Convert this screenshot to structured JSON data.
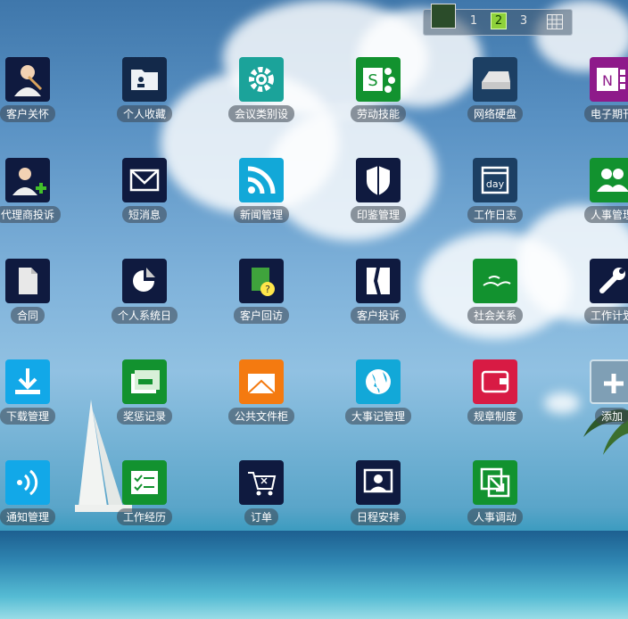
{
  "pager": {
    "pages": [
      "1",
      "2",
      "3"
    ],
    "active_page": "2"
  },
  "apps": [
    {
      "label": "客户关怀",
      "color": "#0f1a3f",
      "icon": "customer-care-icon"
    },
    {
      "label": "个人收藏",
      "color": "#13294a",
      "icon": "contact-card-icon"
    },
    {
      "label": "会议类别设",
      "color": "#1ba39a",
      "icon": "gear-icon"
    },
    {
      "label": "劳动技能",
      "color": "#12922f",
      "icon": "sharepoint-icon"
    },
    {
      "label": "网络硬盘",
      "color": "#1c3f63",
      "icon": "hard-drive-icon"
    },
    {
      "label": "电子期刊",
      "color": "#8e1a8a",
      "icon": "onenote-icon"
    },
    {
      "label": "代理商投诉",
      "color": "#0f1a3f",
      "icon": "add-user-icon"
    },
    {
      "label": "短消息",
      "color": "#0f1a3f",
      "icon": "envelope-icon"
    },
    {
      "label": "新闻管理",
      "color": "#12a8d8",
      "icon": "rss-icon"
    },
    {
      "label": "印鉴管理",
      "color": "#0f1a3f",
      "icon": "shield-icon"
    },
    {
      "label": "工作日志",
      "color": "#1c3f63",
      "icon": "calendar-day-icon",
      "day": "day"
    },
    {
      "label": "人事管理",
      "color": "#12922f",
      "icon": "people-icon"
    },
    {
      "label": "合同",
      "color": "#0f1a3f",
      "icon": "document-icon"
    },
    {
      "label": "个人系统日",
      "color": "#0f1a3f",
      "icon": "pie-chart-icon"
    },
    {
      "label": "客户回访",
      "color": "#0f1a3f",
      "icon": "help-document-icon"
    },
    {
      "label": "客户投诉",
      "color": "#0f1a3f",
      "icon": "torn-document-icon"
    },
    {
      "label": "社会关系",
      "color": "#12922f",
      "icon": "birds-icon"
    },
    {
      "label": "工作计划",
      "color": "#0f1a3f",
      "icon": "wrench-icon"
    },
    {
      "label": "下载管理",
      "color": "#12a8e8",
      "icon": "download-icon"
    },
    {
      "label": "奖惩记录",
      "color": "#12922f",
      "icon": "cards-icon"
    },
    {
      "label": "公共文件柜",
      "color": "#f47a10",
      "icon": "mail-open-icon"
    },
    {
      "label": "大事记管理",
      "color": "#12a8d8",
      "icon": "globe-icon"
    },
    {
      "label": "规章制度",
      "color": "#d81b44",
      "icon": "wallet-icon"
    },
    {
      "label": "添加",
      "color": "#7f9fb5",
      "icon": "plus-icon"
    },
    {
      "label": "通知管理",
      "color": "#12a8e8",
      "icon": "signal-icon"
    },
    {
      "label": "工作经历",
      "color": "#12922f",
      "icon": "checklist-icon"
    },
    {
      "label": "订单",
      "color": "#0f1a3f",
      "icon": "cart-icon"
    },
    {
      "label": "日程安排",
      "color": "#0f1a3f",
      "icon": "presenter-icon"
    },
    {
      "label": "人事调动",
      "color": "#12922f",
      "icon": "transfer-icon"
    }
  ]
}
